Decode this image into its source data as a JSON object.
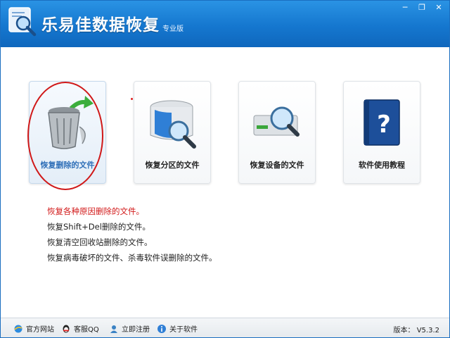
{
  "titlebar": {
    "title": "乐易佳数据恢复",
    "edition": "专业版",
    "buttons": {
      "menu": "─",
      "restore": "❐",
      "close": "✕"
    },
    "colors": {
      "bar_top": "#2a93e4",
      "bar_bottom": "#0f67bd"
    }
  },
  "cards": [
    {
      "label": "恢复删除的文件",
      "icon": "recycle-bin-icon",
      "selected": true
    },
    {
      "label": "恢复分区的文件",
      "icon": "disk-search-icon",
      "selected": false
    },
    {
      "label": "恢复设备的文件",
      "icon": "drive-search-icon",
      "selected": false
    },
    {
      "label": "软件使用教程",
      "icon": "help-book-icon",
      "selected": false
    }
  ],
  "description": [
    "恢复各种原因删除的文件。",
    "恢复Shift+Del删除的文件。",
    "恢复清空回收站删除的文件。",
    "恢复病毒破坏的文件、杀毒软件误删除的文件。"
  ],
  "statusbar": {
    "links": [
      {
        "label": "官方网站",
        "icon": "ie-globe-icon"
      },
      {
        "label": "客服QQ",
        "icon": "qq-penguin-icon"
      },
      {
        "label": "立即注册",
        "icon": "register-icon"
      },
      {
        "label": "关于软件",
        "icon": "info-icon"
      }
    ],
    "version": "版本： V5.3.2"
  },
  "accent": {
    "selected_label": "#2f6fb8",
    "annotation_red": "#d01818"
  }
}
